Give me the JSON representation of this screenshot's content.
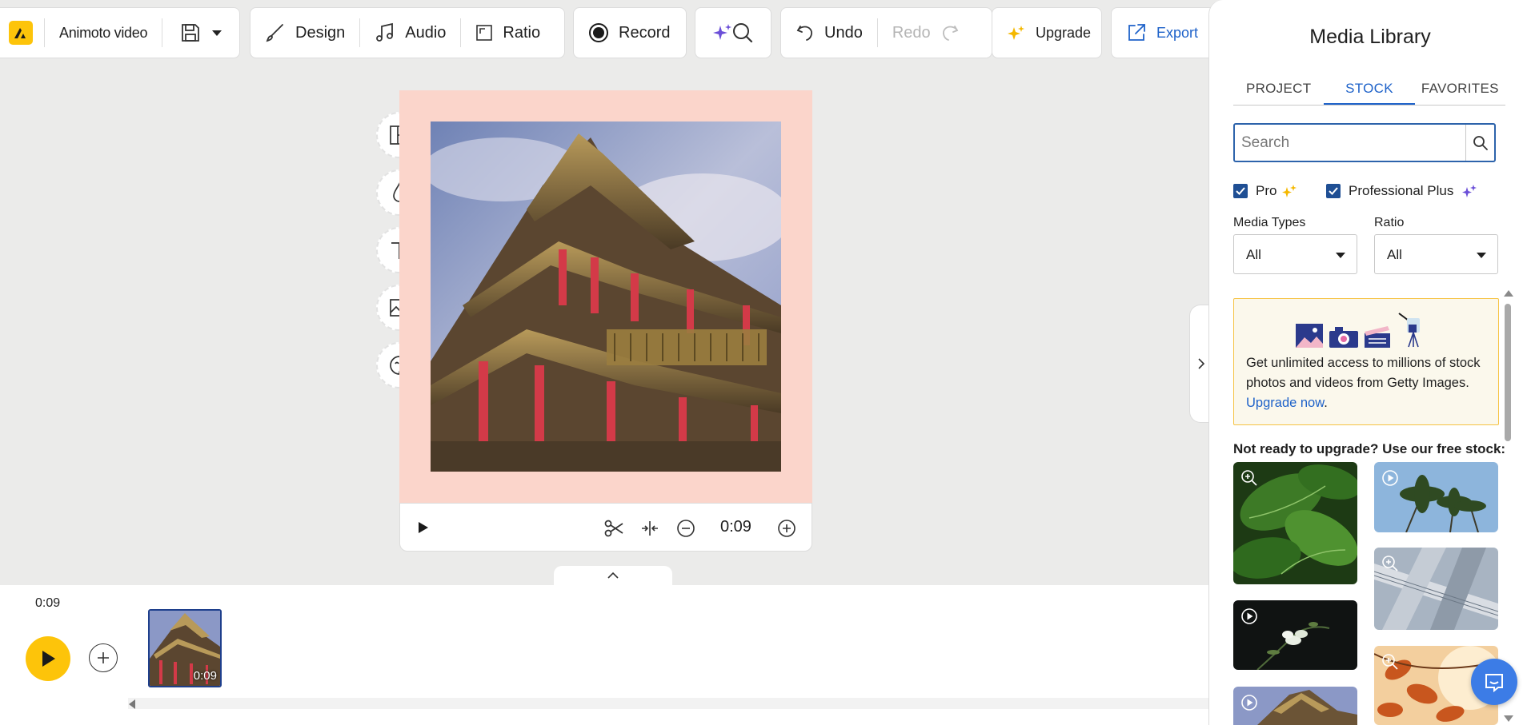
{
  "toolbar": {
    "project_title": "Animoto video",
    "design_label": "Design",
    "audio_label": "Audio",
    "ratio_label": "Ratio",
    "record_label": "Record",
    "undo_label": "Undo",
    "redo_label": "Redo",
    "upgrade_label": "Upgrade",
    "export_label": "Export"
  },
  "preview": {
    "duration": "0:09",
    "background_color": "#fbd5cb"
  },
  "timeline": {
    "current_time": "0:09",
    "clips": [
      {
        "duration": "0:09"
      }
    ]
  },
  "media_library": {
    "title": "Media Library",
    "tabs": [
      {
        "label": "PROJECT",
        "active": false
      },
      {
        "label": "STOCK",
        "active": true
      },
      {
        "label": "FAVORITES",
        "active": false
      }
    ],
    "search_placeholder": "Search",
    "filters": {
      "pro_label": "Pro",
      "pro_checked": true,
      "pro_plus_label": "Professional Plus",
      "pro_plus_checked": true,
      "media_types_label": "Media Types",
      "media_types_value": "All",
      "ratio_label": "Ratio",
      "ratio_value": "All"
    },
    "promo": {
      "text": "Get unlimited access to millions of stock photos and videos from Getty Images.",
      "link": "Upgrade now",
      "after_link": "."
    },
    "free_stock_label": "Not ready to upgrade? Use our free stock:"
  },
  "colors": {
    "accent_blue": "#1e62c9",
    "brand_yellow": "#fdc40a",
    "promo_border": "#f6c344"
  }
}
